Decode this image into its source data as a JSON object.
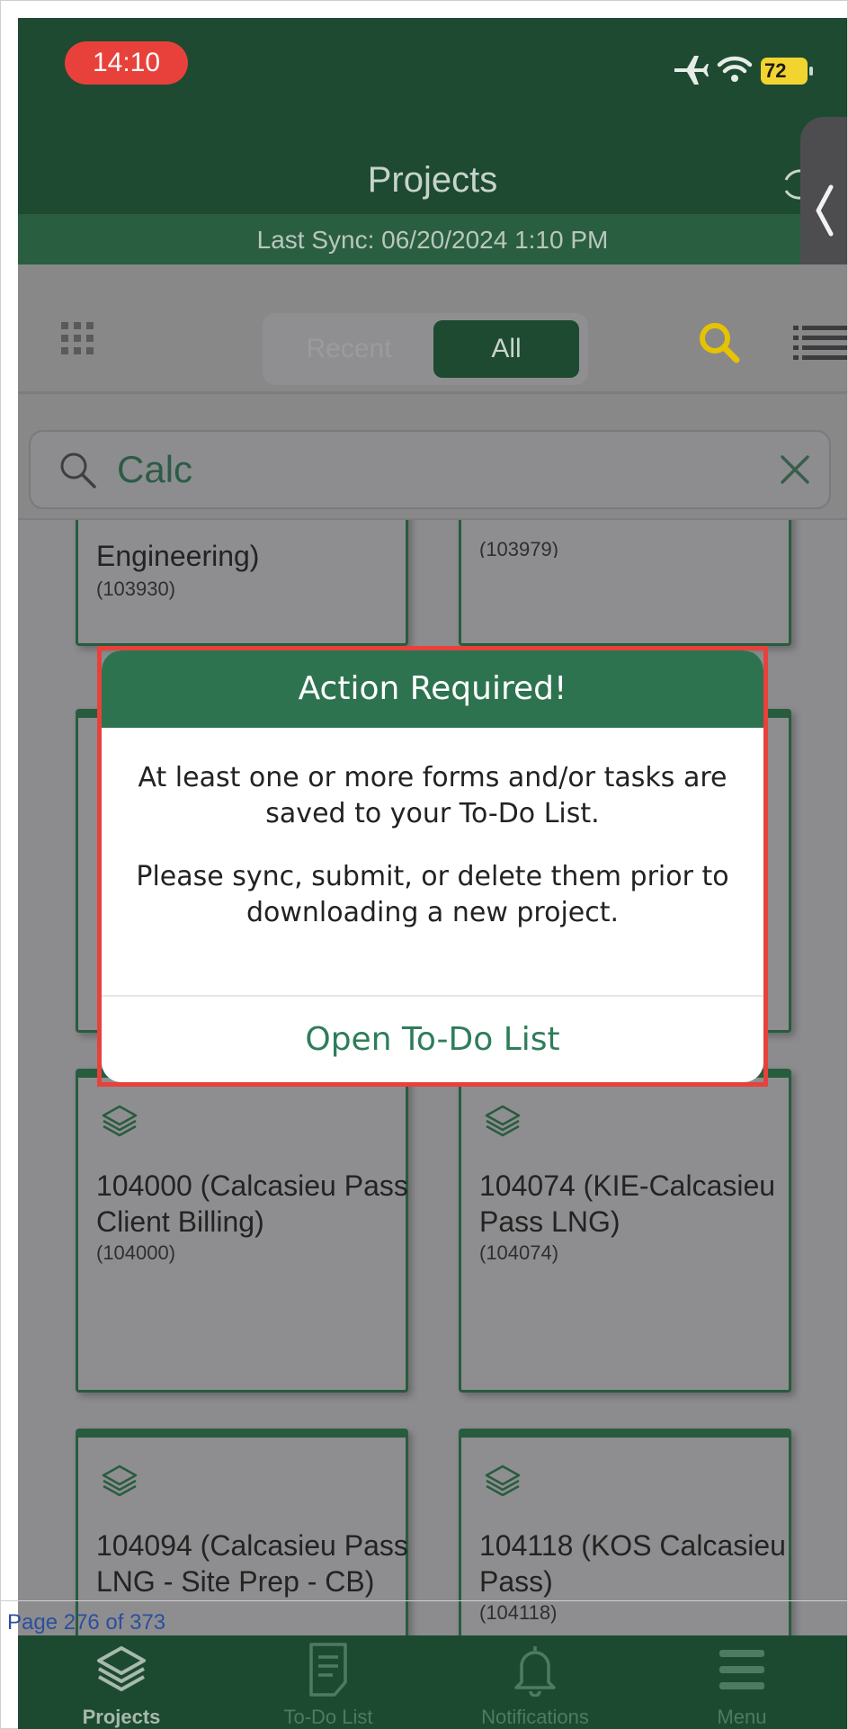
{
  "status_bar": {
    "time": "14:10",
    "battery": "72"
  },
  "nav": {
    "title": "Projects",
    "last_sync": "Last Sync: 06/20/2024 1:10 PM"
  },
  "toolbar": {
    "segments": [
      "Recent",
      "All"
    ],
    "selected_segment": "All"
  },
  "search": {
    "value": "Calc"
  },
  "cards": [
    {
      "title": "Engineering)",
      "code": "(103930)"
    },
    {
      "title": "",
      "code": "(103979)"
    },
    {
      "title": "104000 (Calcasieu Pass Client Billing)",
      "code": "(104000)"
    },
    {
      "title": "104074 (KIE-Calcasieu Pass LNG)",
      "code": "(104074)"
    },
    {
      "title": "104094 (Calcasieu Pass LNG - Site Prep - CB)",
      "code": ""
    },
    {
      "title": "104118 (KOS Calcasieu Pass)",
      "code": "(104118)"
    }
  ],
  "modal": {
    "title": "Action Required!",
    "message_1": "At least one or more forms and/or tasks are saved to your To-Do List.",
    "message_2": "Please sync, submit, or delete them prior to downloading a new project.",
    "action": "Open To-Do List"
  },
  "tabs": [
    {
      "label": "Projects",
      "icon": "layers-icon"
    },
    {
      "label": "To-Do List",
      "icon": "document-icon"
    },
    {
      "label": "Notifications",
      "icon": "bell-icon"
    },
    {
      "label": "Menu",
      "icon": "hamburger-icon"
    }
  ],
  "document_footer": "Page 276 of 373",
  "colors": {
    "brand_green": "#1d4a31",
    "accent_green": "#2e7350",
    "highlight_red": "#e8413c",
    "search_yellow": "#e6c200"
  }
}
